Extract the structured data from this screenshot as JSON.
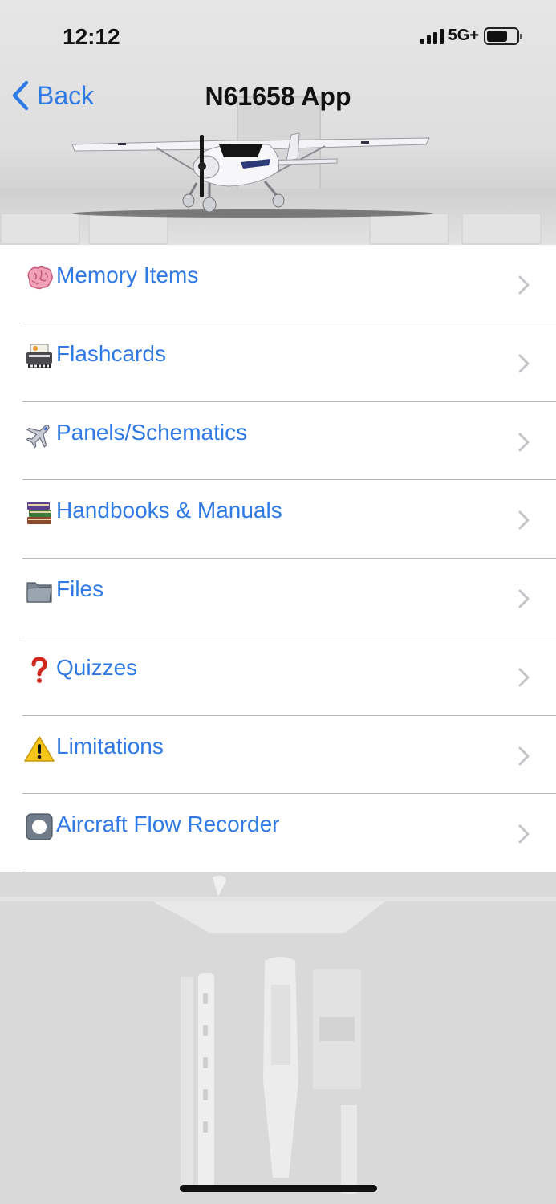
{
  "status_bar": {
    "time": "12:12",
    "network": "5G+",
    "battery_percent": 70,
    "signal_bars": 4
  },
  "nav": {
    "back_label": "Back",
    "title": "N61658 App"
  },
  "colors": {
    "accent": "#2f7ae5",
    "divider": "#b8b8b8",
    "chevron": "#c4c4c8"
  },
  "menu": {
    "items": [
      {
        "label": "Memory Items",
        "icon": "brain-icon"
      },
      {
        "label": "Flashcards",
        "icon": "flashcards-icon"
      },
      {
        "label": "Panels/Schematics",
        "icon": "airplane-icon"
      },
      {
        "label": "Handbooks & Manuals",
        "icon": "books-icon"
      },
      {
        "label": "Files",
        "icon": "folder-icon"
      },
      {
        "label": "Quizzes",
        "icon": "question-mark-icon"
      },
      {
        "label": "Limitations",
        "icon": "warning-icon"
      },
      {
        "label": "Aircraft Flow Recorder",
        "icon": "record-button-icon"
      }
    ]
  }
}
